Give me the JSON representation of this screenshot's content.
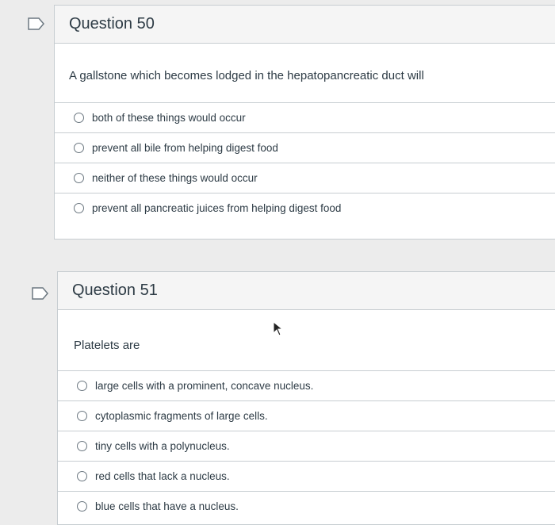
{
  "q50": {
    "title": "Question 50",
    "prompt": "A gallstone which becomes lodged in the hepatopancreatic duct will",
    "answers": [
      "both of these things would occur",
      "prevent all bile from helping digest food",
      "neither of these things would occur",
      "prevent all pancreatic juices from helping digest food"
    ]
  },
  "q51": {
    "title": "Question 51",
    "prompt": "Platelets are",
    "answers": [
      "large cells with a prominent, concave nucleus.",
      "cytoplasmic fragments of large cells.",
      "tiny cells with a polynucleus.",
      "red cells that lack a nucleus.",
      "blue cells that have a nucleus."
    ]
  },
  "icons": [
    "flag-icon",
    "mouse-cursor-icon"
  ],
  "colors": {
    "border": "#c7cdd1",
    "header_bg": "#f5f5f5",
    "text": "#2d3b45",
    "page_bg": "#ececec"
  }
}
